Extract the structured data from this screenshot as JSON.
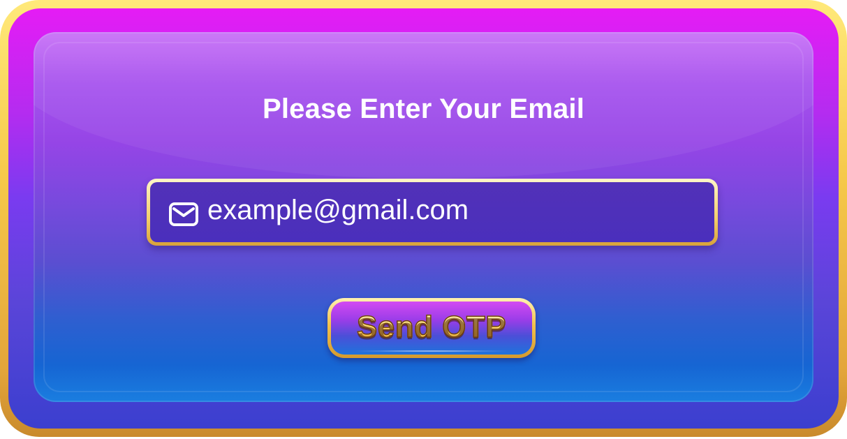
{
  "dialog": {
    "title": "Please Enter Your Email"
  },
  "email": {
    "icon": "mail-icon",
    "placeholder": "example@gmail.com",
    "value": ""
  },
  "send_button": {
    "label": "Send OTP"
  },
  "colors": {
    "frame_gold": "#f6c94a",
    "rim_magenta": "#e51cf5",
    "panel_purple": "#9545e6",
    "panel_blue": "#1665d3",
    "input_bg": "#4a2fbc",
    "button_text_gold": "#ffd866"
  }
}
